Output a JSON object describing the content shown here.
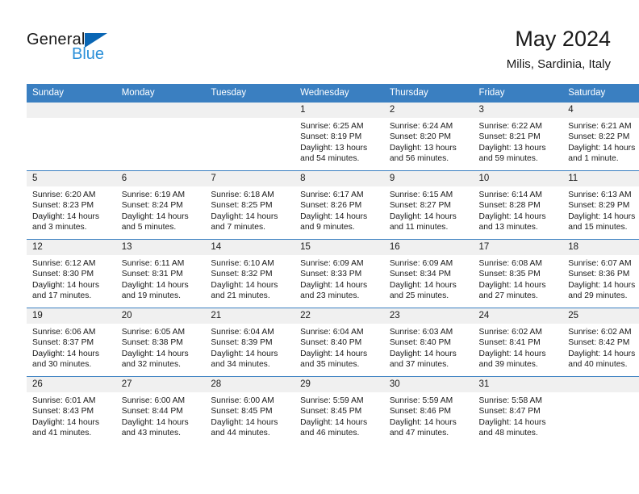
{
  "brand": {
    "name_top": "General",
    "name_bottom": "Blue",
    "accent_color": "#0a66b4",
    "accent_light": "#2a8fd8"
  },
  "header": {
    "title": "May 2024",
    "subtitle": "Milis, Sardinia, Italy"
  },
  "theme": {
    "header_bg": "#3a7fc1",
    "daynum_bg": "#f0f0f0",
    "text": "#1a1a1a"
  },
  "weekday_headers": [
    "Sunday",
    "Monday",
    "Tuesday",
    "Wednesday",
    "Thursday",
    "Friday",
    "Saturday"
  ],
  "weeks": [
    [
      {
        "day": "",
        "sunrise": "",
        "sunset": "",
        "daylight_1": "",
        "daylight_2": "",
        "empty": true
      },
      {
        "day": "",
        "sunrise": "",
        "sunset": "",
        "daylight_1": "",
        "daylight_2": "",
        "empty": true
      },
      {
        "day": "",
        "sunrise": "",
        "sunset": "",
        "daylight_1": "",
        "daylight_2": "",
        "empty": true
      },
      {
        "day": "1",
        "sunrise": "Sunrise: 6:25 AM",
        "sunset": "Sunset: 8:19 PM",
        "daylight_1": "Daylight: 13 hours",
        "daylight_2": "and 54 minutes."
      },
      {
        "day": "2",
        "sunrise": "Sunrise: 6:24 AM",
        "sunset": "Sunset: 8:20 PM",
        "daylight_1": "Daylight: 13 hours",
        "daylight_2": "and 56 minutes."
      },
      {
        "day": "3",
        "sunrise": "Sunrise: 6:22 AM",
        "sunset": "Sunset: 8:21 PM",
        "daylight_1": "Daylight: 13 hours",
        "daylight_2": "and 59 minutes."
      },
      {
        "day": "4",
        "sunrise": "Sunrise: 6:21 AM",
        "sunset": "Sunset: 8:22 PM",
        "daylight_1": "Daylight: 14 hours",
        "daylight_2": "and 1 minute."
      }
    ],
    [
      {
        "day": "5",
        "sunrise": "Sunrise: 6:20 AM",
        "sunset": "Sunset: 8:23 PM",
        "daylight_1": "Daylight: 14 hours",
        "daylight_2": "and 3 minutes."
      },
      {
        "day": "6",
        "sunrise": "Sunrise: 6:19 AM",
        "sunset": "Sunset: 8:24 PM",
        "daylight_1": "Daylight: 14 hours",
        "daylight_2": "and 5 minutes."
      },
      {
        "day": "7",
        "sunrise": "Sunrise: 6:18 AM",
        "sunset": "Sunset: 8:25 PM",
        "daylight_1": "Daylight: 14 hours",
        "daylight_2": "and 7 minutes."
      },
      {
        "day": "8",
        "sunrise": "Sunrise: 6:17 AM",
        "sunset": "Sunset: 8:26 PM",
        "daylight_1": "Daylight: 14 hours",
        "daylight_2": "and 9 minutes."
      },
      {
        "day": "9",
        "sunrise": "Sunrise: 6:15 AM",
        "sunset": "Sunset: 8:27 PM",
        "daylight_1": "Daylight: 14 hours",
        "daylight_2": "and 11 minutes."
      },
      {
        "day": "10",
        "sunrise": "Sunrise: 6:14 AM",
        "sunset": "Sunset: 8:28 PM",
        "daylight_1": "Daylight: 14 hours",
        "daylight_2": "and 13 minutes."
      },
      {
        "day": "11",
        "sunrise": "Sunrise: 6:13 AM",
        "sunset": "Sunset: 8:29 PM",
        "daylight_1": "Daylight: 14 hours",
        "daylight_2": "and 15 minutes."
      }
    ],
    [
      {
        "day": "12",
        "sunrise": "Sunrise: 6:12 AM",
        "sunset": "Sunset: 8:30 PM",
        "daylight_1": "Daylight: 14 hours",
        "daylight_2": "and 17 minutes."
      },
      {
        "day": "13",
        "sunrise": "Sunrise: 6:11 AM",
        "sunset": "Sunset: 8:31 PM",
        "daylight_1": "Daylight: 14 hours",
        "daylight_2": "and 19 minutes."
      },
      {
        "day": "14",
        "sunrise": "Sunrise: 6:10 AM",
        "sunset": "Sunset: 8:32 PM",
        "daylight_1": "Daylight: 14 hours",
        "daylight_2": "and 21 minutes."
      },
      {
        "day": "15",
        "sunrise": "Sunrise: 6:09 AM",
        "sunset": "Sunset: 8:33 PM",
        "daylight_1": "Daylight: 14 hours",
        "daylight_2": "and 23 minutes."
      },
      {
        "day": "16",
        "sunrise": "Sunrise: 6:09 AM",
        "sunset": "Sunset: 8:34 PM",
        "daylight_1": "Daylight: 14 hours",
        "daylight_2": "and 25 minutes."
      },
      {
        "day": "17",
        "sunrise": "Sunrise: 6:08 AM",
        "sunset": "Sunset: 8:35 PM",
        "daylight_1": "Daylight: 14 hours",
        "daylight_2": "and 27 minutes."
      },
      {
        "day": "18",
        "sunrise": "Sunrise: 6:07 AM",
        "sunset": "Sunset: 8:36 PM",
        "daylight_1": "Daylight: 14 hours",
        "daylight_2": "and 29 minutes."
      }
    ],
    [
      {
        "day": "19",
        "sunrise": "Sunrise: 6:06 AM",
        "sunset": "Sunset: 8:37 PM",
        "daylight_1": "Daylight: 14 hours",
        "daylight_2": "and 30 minutes."
      },
      {
        "day": "20",
        "sunrise": "Sunrise: 6:05 AM",
        "sunset": "Sunset: 8:38 PM",
        "daylight_1": "Daylight: 14 hours",
        "daylight_2": "and 32 minutes."
      },
      {
        "day": "21",
        "sunrise": "Sunrise: 6:04 AM",
        "sunset": "Sunset: 8:39 PM",
        "daylight_1": "Daylight: 14 hours",
        "daylight_2": "and 34 minutes."
      },
      {
        "day": "22",
        "sunrise": "Sunrise: 6:04 AM",
        "sunset": "Sunset: 8:40 PM",
        "daylight_1": "Daylight: 14 hours",
        "daylight_2": "and 35 minutes."
      },
      {
        "day": "23",
        "sunrise": "Sunrise: 6:03 AM",
        "sunset": "Sunset: 8:40 PM",
        "daylight_1": "Daylight: 14 hours",
        "daylight_2": "and 37 minutes."
      },
      {
        "day": "24",
        "sunrise": "Sunrise: 6:02 AM",
        "sunset": "Sunset: 8:41 PM",
        "daylight_1": "Daylight: 14 hours",
        "daylight_2": "and 39 minutes."
      },
      {
        "day": "25",
        "sunrise": "Sunrise: 6:02 AM",
        "sunset": "Sunset: 8:42 PM",
        "daylight_1": "Daylight: 14 hours",
        "daylight_2": "and 40 minutes."
      }
    ],
    [
      {
        "day": "26",
        "sunrise": "Sunrise: 6:01 AM",
        "sunset": "Sunset: 8:43 PM",
        "daylight_1": "Daylight: 14 hours",
        "daylight_2": "and 41 minutes."
      },
      {
        "day": "27",
        "sunrise": "Sunrise: 6:00 AM",
        "sunset": "Sunset: 8:44 PM",
        "daylight_1": "Daylight: 14 hours",
        "daylight_2": "and 43 minutes."
      },
      {
        "day": "28",
        "sunrise": "Sunrise: 6:00 AM",
        "sunset": "Sunset: 8:45 PM",
        "daylight_1": "Daylight: 14 hours",
        "daylight_2": "and 44 minutes."
      },
      {
        "day": "29",
        "sunrise": "Sunrise: 5:59 AM",
        "sunset": "Sunset: 8:45 PM",
        "daylight_1": "Daylight: 14 hours",
        "daylight_2": "and 46 minutes."
      },
      {
        "day": "30",
        "sunrise": "Sunrise: 5:59 AM",
        "sunset": "Sunset: 8:46 PM",
        "daylight_1": "Daylight: 14 hours",
        "daylight_2": "and 47 minutes."
      },
      {
        "day": "31",
        "sunrise": "Sunrise: 5:58 AM",
        "sunset": "Sunset: 8:47 PM",
        "daylight_1": "Daylight: 14 hours",
        "daylight_2": "and 48 minutes."
      },
      {
        "day": "",
        "sunrise": "",
        "sunset": "",
        "daylight_1": "",
        "daylight_2": "",
        "empty": true
      }
    ]
  ]
}
